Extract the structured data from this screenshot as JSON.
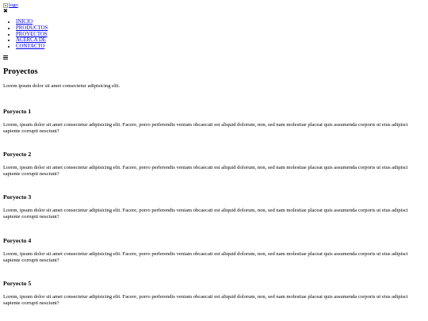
{
  "header": {
    "logo_alt": "logo"
  },
  "nav": {
    "items": [
      {
        "label": "INICIO"
      },
      {
        "label": "PRODUCTOS"
      },
      {
        "label": "PROYECTOS"
      },
      {
        "label": "ACERCA DE"
      },
      {
        "label": "CONTACTO"
      }
    ]
  },
  "main": {
    "title": "Proyectos",
    "intro": "Lorem ipsum dolor sit amet consectetur adipisicing elit.",
    "projects": [
      {
        "title": "Poryecto 1",
        "body": "Lorem, ipsum dolor sit amet consectetur adipisicing elit. Facere, porro perferendis veniam obcaecati est aliquid dolorum, non, sed nam molestiae placeat quis assumenda corporis ut eius adipisci sapiente corrupti nesciunt?"
      },
      {
        "title": "Poryecto 2",
        "body": "Lorem, ipsum dolor sit amet consectetur adipisicing elit. Facere, porro perferendis veniam obcaecati est aliquid dolorum, non, sed nam molestiae placeat quis assumenda corporis ut eius adipisci sapiente corrupti nesciunt?"
      },
      {
        "title": "Poryecto 3",
        "body": "Lorem, ipsum dolor sit amet consectetur adipisicing elit. Facere, porro perferendis veniam obcaecati est aliquid dolorum, non, sed nam molestiae placeat quis assumenda corporis ut eius adipisci sapiente corrupti nesciunt?"
      },
      {
        "title": "Poryecto 4",
        "body": "Lorem, ipsum dolor sit amet consectetur adipisicing elit. Facere, porro perferendis veniam obcaecati est aliquid dolorum, non, sed nam molestiae placeat quis assumenda corporis ut eius adipisci sapiente corrupti nesciunt?"
      },
      {
        "title": "Poryecto 5",
        "body": "Lorem, ipsum dolor sit amet consectetur adipisicing elit. Facere, porro perferendis veniam obcaecati est aliquid dolorum, non, sed nam molestiae placeat quis assumenda corporis ut eius adipisci sapiente corrupti nesciunt?"
      }
    ]
  }
}
